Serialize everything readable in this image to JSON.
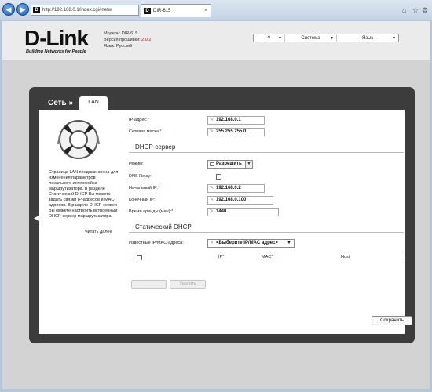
{
  "browser": {
    "address": "http://192.168.0.1/index.cgi#netw",
    "favicon_letter": "D",
    "tab_title": "DIR-615"
  },
  "header": {
    "logo": "D-Link",
    "tagline": "Building Networks for People",
    "model_label": "Модель:",
    "model_value": "DIR-615",
    "firmware_label": "Версия прошивки:",
    "firmware_value": "2.0.2",
    "language_label": "Язык:",
    "language_value": "Русский"
  },
  "menu": {
    "items": [
      "Система",
      "Язык"
    ]
  },
  "breadcrumb": {
    "section": "Сеть »",
    "tab": "LAN"
  },
  "help": {
    "text": "Страница LAN предназначена для изменения параметров локального интерфейса маршрутизатора. В разделе Статический DHCP Вы можете задать связки IP-адресов и MAC-адресов. В разделе DHCP-сервер Вы можете настроить встроенный DHCP-сервер маршрутизатора.",
    "more_link": "Читать далее"
  },
  "lan": {
    "ip_label": "IP-адрес:",
    "ip_value": "192.168.0.1",
    "mask_label": "Сетевая маска:",
    "mask_value": "255.255.255.0"
  },
  "dhcp": {
    "title": "DHCP-сервер",
    "mode_label": "Режим:",
    "mode_value": "Разрешить",
    "relay_label": "DNS Relay:",
    "start_label": "Начальный IP:",
    "start_value": "192.168.0.2",
    "end_label": "Конечный IP:",
    "end_value": "192.168.0.100",
    "lease_label": "Время аренды (мин):",
    "lease_value": "1440"
  },
  "static_dhcp": {
    "title": "Статический DHCP",
    "known_label": "Известные IP/MAC-адреса:",
    "known_value": "<Выберите IP/MAC адрес>",
    "col_ip": "IP",
    "col_mac": "MAC",
    "col_host": "Host",
    "delete_label": "Удалить"
  },
  "save_label": "Сохранить"
}
